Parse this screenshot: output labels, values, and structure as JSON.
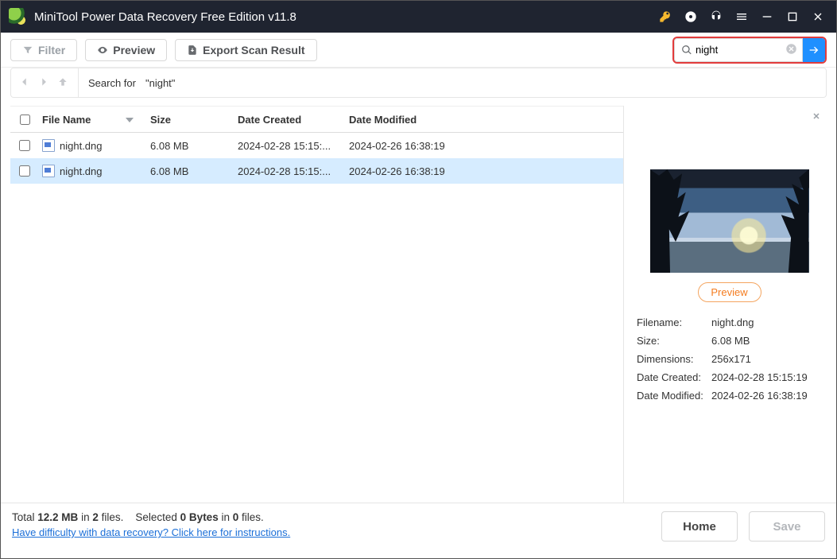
{
  "app": {
    "title": "MiniTool Power Data Recovery Free Edition v11.8"
  },
  "toolbar": {
    "filter": "Filter",
    "preview": "Preview",
    "export": "Export Scan Result"
  },
  "search": {
    "value": "night"
  },
  "breadcrumb": {
    "prefix": "Search for",
    "term": "\"night\""
  },
  "columns": {
    "name": "File Name",
    "size": "Size",
    "created": "Date Created",
    "modified": "Date Modified"
  },
  "files": [
    {
      "name": "night.dng",
      "size": "6.08 MB",
      "created": "2024-02-28 15:15:...",
      "modified": "2024-02-26 16:38:19",
      "selected": false
    },
    {
      "name": "night.dng",
      "size": "6.08 MB",
      "created": "2024-02-28 15:15:...",
      "modified": "2024-02-26 16:38:19",
      "selected": true
    }
  ],
  "preview": {
    "button": "Preview",
    "meta": {
      "filename_label": "Filename:",
      "filename": "night.dng",
      "size_label": "Size:",
      "size": "6.08 MB",
      "dimensions_label": "Dimensions:",
      "dimensions": "256x171",
      "created_label": "Date Created:",
      "created": "2024-02-28 15:15:19",
      "modified_label": "Date Modified:",
      "modified": "2024-02-26 16:38:19"
    }
  },
  "footer": {
    "total_label_pre": "Total ",
    "total_size": "12.2 MB",
    "total_mid": " in ",
    "total_files": "2",
    "total_post": " files.",
    "sel_pre": "Selected ",
    "sel_bytes": "0 Bytes",
    "sel_mid": " in ",
    "sel_files": "0",
    "sel_post": " files.",
    "help_link": "Have difficulty with data recovery? Click here for instructions.",
    "home": "Home",
    "save": "Save"
  }
}
